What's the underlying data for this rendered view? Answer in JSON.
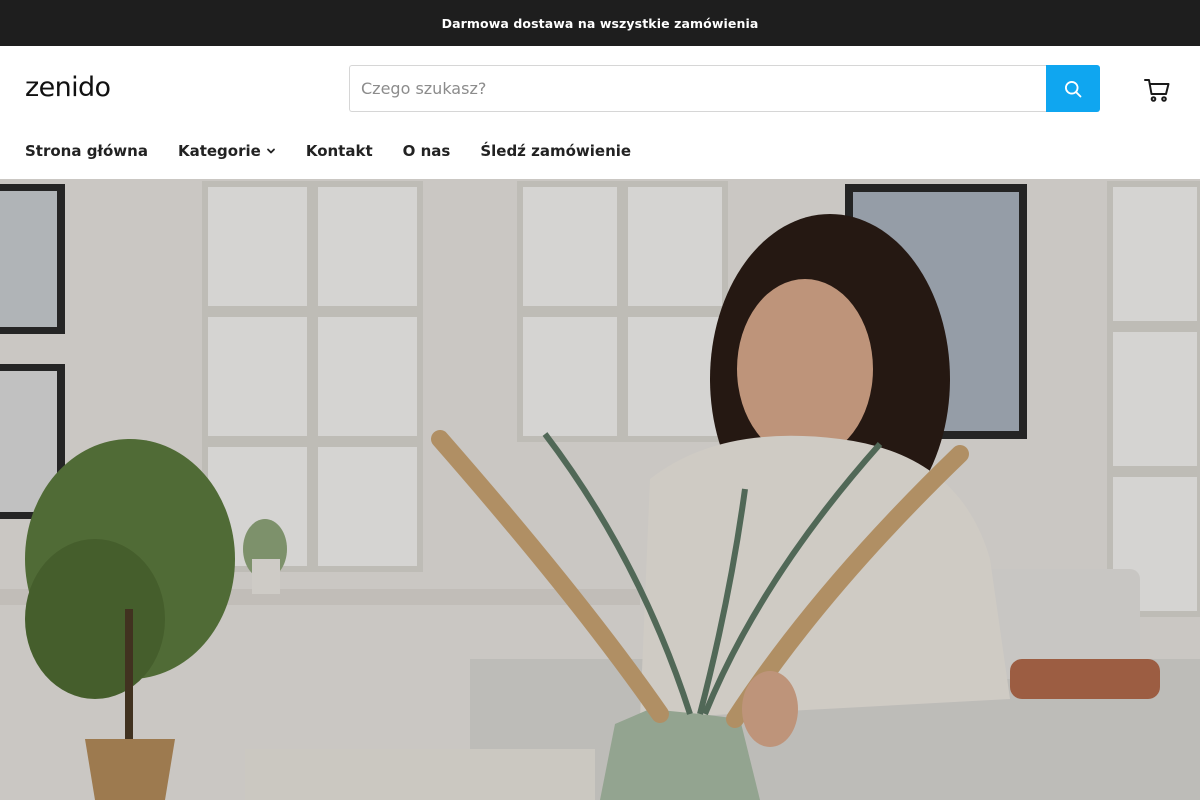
{
  "announcement": {
    "text": "Darmowa dostawa na wszystkie zamówienia"
  },
  "header": {
    "logo": "zenido",
    "search": {
      "placeholder": "Czego szukasz?",
      "value": ""
    },
    "icons": {
      "search": "search-icon",
      "cart": "cart-icon"
    }
  },
  "nav": {
    "items": [
      {
        "label": "Strona główna"
      },
      {
        "label": "Kategorie",
        "icon": "chevron-down-icon"
      },
      {
        "label": "Kontakt"
      },
      {
        "label": "O nas"
      },
      {
        "label": "Śledź zamówienie"
      }
    ]
  },
  "colors": {
    "announcement_bg": "#1e1e1e",
    "accent": "#0fa6f0",
    "text": "#222222"
  }
}
